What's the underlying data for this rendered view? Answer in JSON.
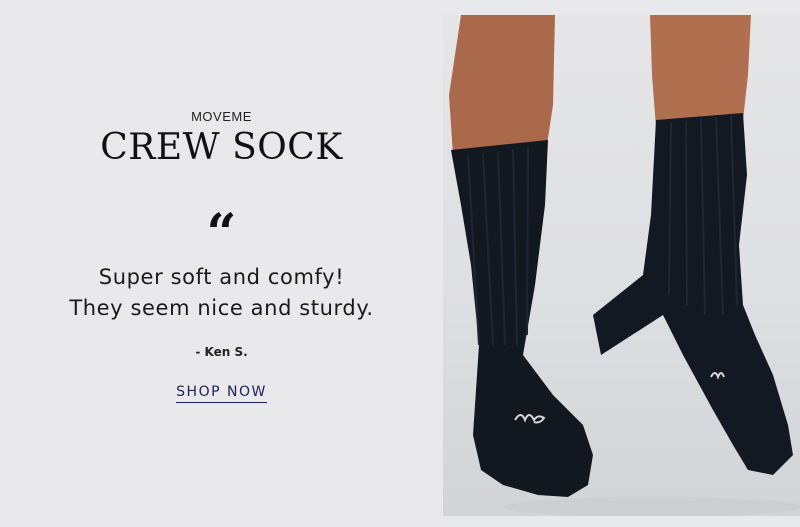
{
  "brand": "MOVEME",
  "title": "CREW SOCK",
  "quote_mark": "“",
  "quote_lines": [
    "Super soft and comfy!",
    "They seem nice and sturdy."
  ],
  "author": "- Ken S.",
  "cta": "SHOP NOW",
  "colors": {
    "background": "#e9e9ec",
    "text": "#111111",
    "link": "#1f2060",
    "sock": "#111820",
    "skin": "#a9694a"
  },
  "image": {
    "subject": "legs-in-black-crew-socks"
  }
}
